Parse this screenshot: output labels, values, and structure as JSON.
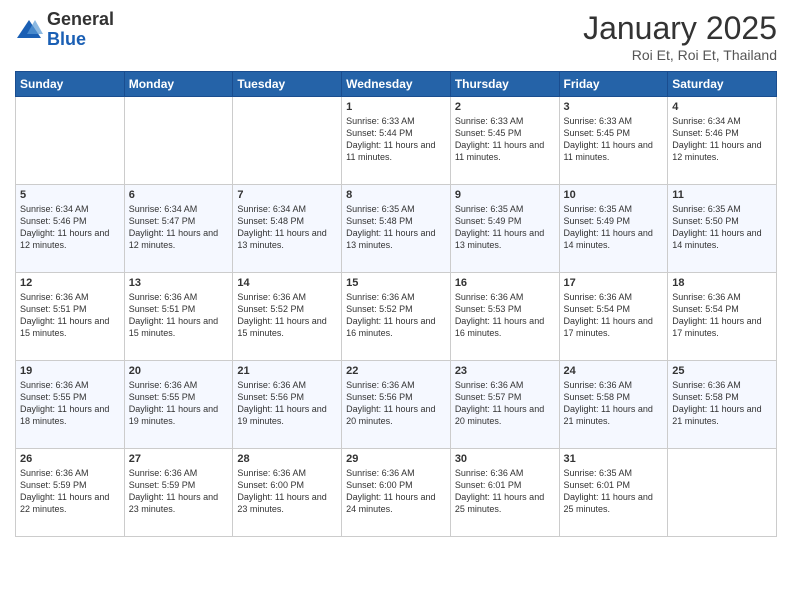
{
  "logo": {
    "general": "General",
    "blue": "Blue"
  },
  "title": "January 2025",
  "subtitle": "Roi Et, Roi Et, Thailand",
  "days_of_week": [
    "Sunday",
    "Monday",
    "Tuesday",
    "Wednesday",
    "Thursday",
    "Friday",
    "Saturday"
  ],
  "weeks": [
    [
      {
        "day": "",
        "content": ""
      },
      {
        "day": "",
        "content": ""
      },
      {
        "day": "",
        "content": ""
      },
      {
        "day": "1",
        "content": "Sunrise: 6:33 AM\nSunset: 5:44 PM\nDaylight: 11 hours and 11 minutes."
      },
      {
        "day": "2",
        "content": "Sunrise: 6:33 AM\nSunset: 5:45 PM\nDaylight: 11 hours and 11 minutes."
      },
      {
        "day": "3",
        "content": "Sunrise: 6:33 AM\nSunset: 5:45 PM\nDaylight: 11 hours and 11 minutes."
      },
      {
        "day": "4",
        "content": "Sunrise: 6:34 AM\nSunset: 5:46 PM\nDaylight: 11 hours and 12 minutes."
      }
    ],
    [
      {
        "day": "5",
        "content": "Sunrise: 6:34 AM\nSunset: 5:46 PM\nDaylight: 11 hours and 12 minutes."
      },
      {
        "day": "6",
        "content": "Sunrise: 6:34 AM\nSunset: 5:47 PM\nDaylight: 11 hours and 12 minutes."
      },
      {
        "day": "7",
        "content": "Sunrise: 6:34 AM\nSunset: 5:48 PM\nDaylight: 11 hours and 13 minutes."
      },
      {
        "day": "8",
        "content": "Sunrise: 6:35 AM\nSunset: 5:48 PM\nDaylight: 11 hours and 13 minutes."
      },
      {
        "day": "9",
        "content": "Sunrise: 6:35 AM\nSunset: 5:49 PM\nDaylight: 11 hours and 13 minutes."
      },
      {
        "day": "10",
        "content": "Sunrise: 6:35 AM\nSunset: 5:49 PM\nDaylight: 11 hours and 14 minutes."
      },
      {
        "day": "11",
        "content": "Sunrise: 6:35 AM\nSunset: 5:50 PM\nDaylight: 11 hours and 14 minutes."
      }
    ],
    [
      {
        "day": "12",
        "content": "Sunrise: 6:36 AM\nSunset: 5:51 PM\nDaylight: 11 hours and 15 minutes."
      },
      {
        "day": "13",
        "content": "Sunrise: 6:36 AM\nSunset: 5:51 PM\nDaylight: 11 hours and 15 minutes."
      },
      {
        "day": "14",
        "content": "Sunrise: 6:36 AM\nSunset: 5:52 PM\nDaylight: 11 hours and 15 minutes."
      },
      {
        "day": "15",
        "content": "Sunrise: 6:36 AM\nSunset: 5:52 PM\nDaylight: 11 hours and 16 minutes."
      },
      {
        "day": "16",
        "content": "Sunrise: 6:36 AM\nSunset: 5:53 PM\nDaylight: 11 hours and 16 minutes."
      },
      {
        "day": "17",
        "content": "Sunrise: 6:36 AM\nSunset: 5:54 PM\nDaylight: 11 hours and 17 minutes."
      },
      {
        "day": "18",
        "content": "Sunrise: 6:36 AM\nSunset: 5:54 PM\nDaylight: 11 hours and 17 minutes."
      }
    ],
    [
      {
        "day": "19",
        "content": "Sunrise: 6:36 AM\nSunset: 5:55 PM\nDaylight: 11 hours and 18 minutes."
      },
      {
        "day": "20",
        "content": "Sunrise: 6:36 AM\nSunset: 5:55 PM\nDaylight: 11 hours and 19 minutes."
      },
      {
        "day": "21",
        "content": "Sunrise: 6:36 AM\nSunset: 5:56 PM\nDaylight: 11 hours and 19 minutes."
      },
      {
        "day": "22",
        "content": "Sunrise: 6:36 AM\nSunset: 5:56 PM\nDaylight: 11 hours and 20 minutes."
      },
      {
        "day": "23",
        "content": "Sunrise: 6:36 AM\nSunset: 5:57 PM\nDaylight: 11 hours and 20 minutes."
      },
      {
        "day": "24",
        "content": "Sunrise: 6:36 AM\nSunset: 5:58 PM\nDaylight: 11 hours and 21 minutes."
      },
      {
        "day": "25",
        "content": "Sunrise: 6:36 AM\nSunset: 5:58 PM\nDaylight: 11 hours and 21 minutes."
      }
    ],
    [
      {
        "day": "26",
        "content": "Sunrise: 6:36 AM\nSunset: 5:59 PM\nDaylight: 11 hours and 22 minutes."
      },
      {
        "day": "27",
        "content": "Sunrise: 6:36 AM\nSunset: 5:59 PM\nDaylight: 11 hours and 23 minutes."
      },
      {
        "day": "28",
        "content": "Sunrise: 6:36 AM\nSunset: 6:00 PM\nDaylight: 11 hours and 23 minutes."
      },
      {
        "day": "29",
        "content": "Sunrise: 6:36 AM\nSunset: 6:00 PM\nDaylight: 11 hours and 24 minutes."
      },
      {
        "day": "30",
        "content": "Sunrise: 6:36 AM\nSunset: 6:01 PM\nDaylight: 11 hours and 25 minutes."
      },
      {
        "day": "31",
        "content": "Sunrise: 6:35 AM\nSunset: 6:01 PM\nDaylight: 11 hours and 25 minutes."
      },
      {
        "day": "",
        "content": ""
      }
    ]
  ]
}
